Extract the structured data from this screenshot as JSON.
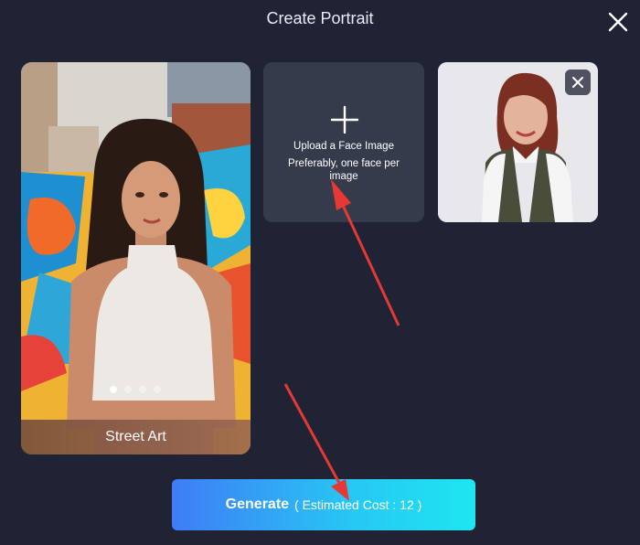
{
  "dialog": {
    "title": "Create Portrait",
    "close_icon": "close-icon"
  },
  "style_card": {
    "label": "Street Art",
    "carousel": {
      "count": 4,
      "active_index": 1
    }
  },
  "upload": {
    "title": "Upload a Face Image",
    "hint": "Preferably, one face per image",
    "icon": "plus-icon"
  },
  "uploaded_face": {
    "remove_icon": "close-icon"
  },
  "generate": {
    "label": "Generate",
    "cost_text": "( Estimated Cost : 12 )"
  },
  "colors": {
    "background": "#1f2333",
    "tile": "#363b4c",
    "generate_start": "#3f7cf6",
    "generate_end": "#1ee6f0",
    "annotation_arrow": "#e53935"
  }
}
